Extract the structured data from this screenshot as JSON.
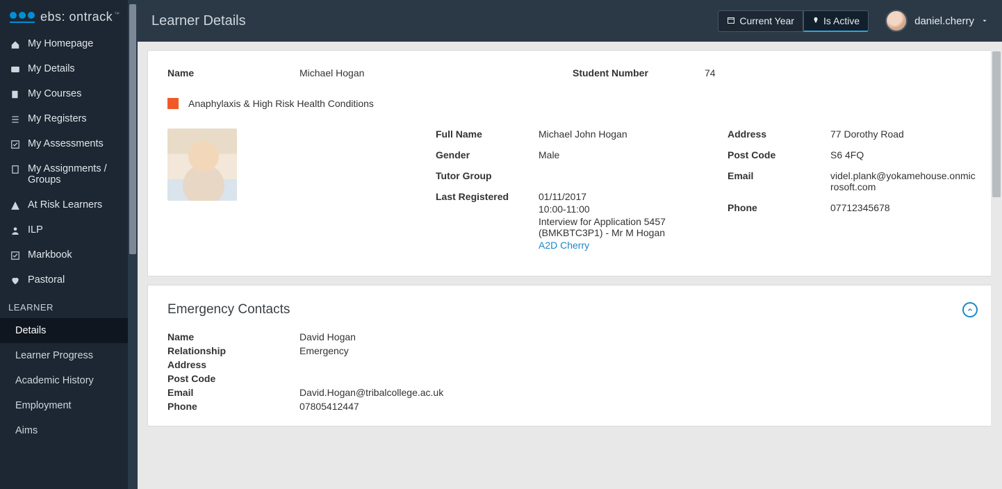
{
  "brand": {
    "name": "ebs:",
    "product": "ontrack",
    "tm": "™"
  },
  "sidebar": {
    "items": [
      {
        "label": "My Homepage"
      },
      {
        "label": "My Details"
      },
      {
        "label": "My Courses"
      },
      {
        "label": "My Registers"
      },
      {
        "label": "My Assessments"
      },
      {
        "label": "My Assignments / Groups"
      },
      {
        "label": "At Risk Learners"
      },
      {
        "label": "ILP"
      },
      {
        "label": "Markbook"
      },
      {
        "label": "Pastoral"
      }
    ],
    "section_label": "LEARNER",
    "sub_items": [
      {
        "label": "Details",
        "active": true
      },
      {
        "label": "Learner Progress"
      },
      {
        "label": "Academic History"
      },
      {
        "label": "Employment"
      },
      {
        "label": "Aims"
      }
    ]
  },
  "header": {
    "title": "Learner Details",
    "filters": {
      "year": "Current Year",
      "active": "Is Active"
    },
    "user": "daniel.cherry"
  },
  "learner": {
    "name_label": "Name",
    "name": "Michael Hogan",
    "student_number_label": "Student Number",
    "student_number": "74",
    "risk_flag": "Anaphylaxis & High Risk Health Conditions",
    "details_left": {
      "full_name_label": "Full Name",
      "full_name": "Michael John Hogan",
      "gender_label": "Gender",
      "gender": "Male",
      "tutor_group_label": "Tutor Group",
      "tutor_group": "",
      "last_registered_label": "Last Registered",
      "last_registered_date": "01/11/2017",
      "last_registered_time": "10:00-11:00",
      "last_registered_desc": "Interview for Application 5457 (BMKBTC3P1) - Mr M Hogan",
      "last_registered_link": "A2D Cherry"
    },
    "details_right": {
      "address_label": "Address",
      "address": "77 Dorothy Road",
      "postcode_label": "Post Code",
      "postcode": "S6 4FQ",
      "email_label": "Email",
      "email": "videl.plank@yokamehouse.onmicrosoft.com",
      "phone_label": "Phone",
      "phone": "07712345678"
    }
  },
  "emergency": {
    "title": "Emergency Contacts",
    "name_label": "Name",
    "name": "David Hogan",
    "relationship_label": "Relationship",
    "relationship": "Emergency",
    "address_label": "Address",
    "address": "",
    "postcode_label": "Post Code",
    "postcode": "",
    "email_label": "Email",
    "email": "David.Hogan@tribalcollege.ac.uk",
    "phone_label": "Phone",
    "phone": "07805412447"
  }
}
